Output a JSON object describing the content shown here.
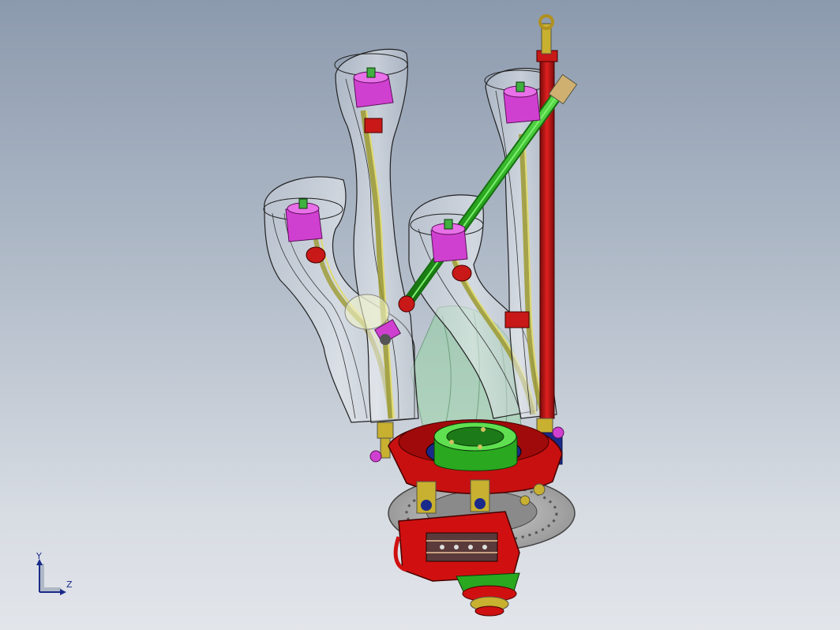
{
  "triad": {
    "y_label": "Y",
    "z_label": "Z"
  },
  "colors": {
    "background_top": "#8c9aae",
    "background_bottom": "#e2e5ea",
    "upright_yellow": "#c8c060",
    "pushrod_green": "#2aa820",
    "spring_red": "#c81818",
    "caliper_red": "#d01010",
    "mount_magenta": "#d040d0",
    "axis_blue": "#1a2a8a"
  },
  "icons": {
    "triad": "coordinate-triad-icon"
  }
}
